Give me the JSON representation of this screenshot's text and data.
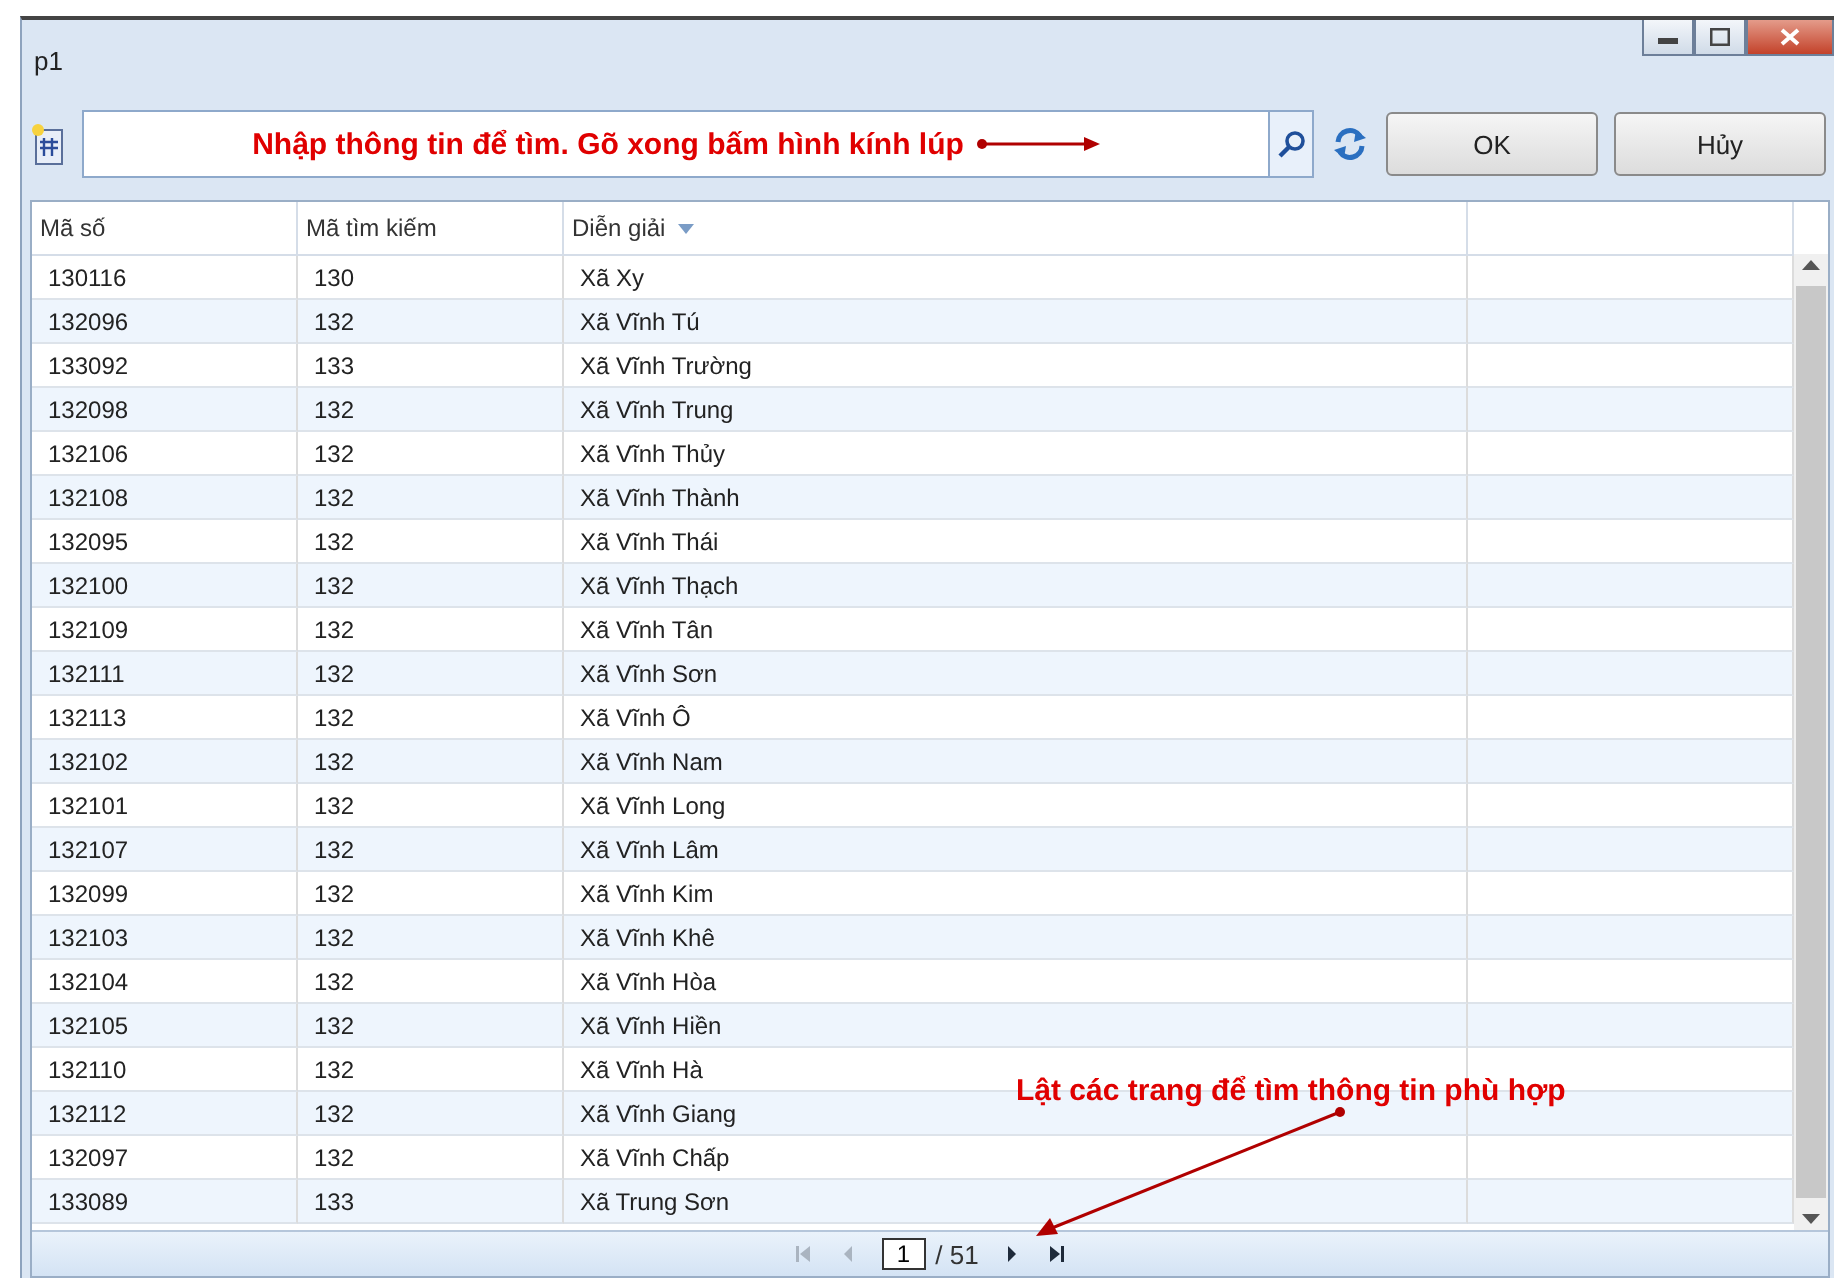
{
  "window": {
    "title": "p1"
  },
  "toolbar": {
    "search": {
      "annotation": "Nhập thông tin để tìm. Gõ xong bấm hình kính lúp"
    },
    "buttons": [
      "OK",
      "Hủy"
    ]
  },
  "table": {
    "columns": [
      {
        "label": "Mã số",
        "sorted": false
      },
      {
        "label": "Mã tìm kiếm",
        "sorted": false
      },
      {
        "label": "Diễn giải",
        "sorted": true
      }
    ],
    "rows": [
      [
        "130116",
        "130",
        "Xã Xy"
      ],
      [
        "132096",
        "132",
        "Xã Vĩnh Tú"
      ],
      [
        "133092",
        "133",
        "Xã Vĩnh Trường"
      ],
      [
        "132098",
        "132",
        "Xã Vĩnh Trung"
      ],
      [
        "132106",
        "132",
        "Xã Vĩnh Thủy"
      ],
      [
        "132108",
        "132",
        "Xã Vĩnh Thành"
      ],
      [
        "132095",
        "132",
        "Xã Vĩnh Thái"
      ],
      [
        "132100",
        "132",
        "Xã Vĩnh Thạch"
      ],
      [
        "132109",
        "132",
        "Xã Vĩnh Tân"
      ],
      [
        "132111",
        "132",
        "Xã Vĩnh Sơn"
      ],
      [
        "132113",
        "132",
        "Xã Vĩnh Ô"
      ],
      [
        "132102",
        "132",
        "Xã Vĩnh Nam"
      ],
      [
        "132101",
        "132",
        "Xã Vĩnh Long"
      ],
      [
        "132107",
        "132",
        "Xã Vĩnh Lâm"
      ],
      [
        "132099",
        "132",
        "Xã Vĩnh Kim"
      ],
      [
        "132103",
        "132",
        "Xã Vĩnh Khê"
      ],
      [
        "132104",
        "132",
        "Xã Vĩnh Hòa"
      ],
      [
        "132105",
        "132",
        "Xã Vĩnh Hiền"
      ],
      [
        "132110",
        "132",
        "Xã Vĩnh Hà"
      ],
      [
        "132112",
        "132",
        "Xã Vĩnh Giang"
      ],
      [
        "132097",
        "132",
        "Xã Vĩnh Chấp"
      ],
      [
        "133089",
        "133",
        "Xã Trung Sơn"
      ]
    ]
  },
  "pager": {
    "page": "1",
    "total": "/ 51",
    "first_disabled": true,
    "prev_disabled": true,
    "next_disabled": false,
    "last_disabled": false
  },
  "annotation": "Lật các trang để tìm thông tin phù hợp"
}
